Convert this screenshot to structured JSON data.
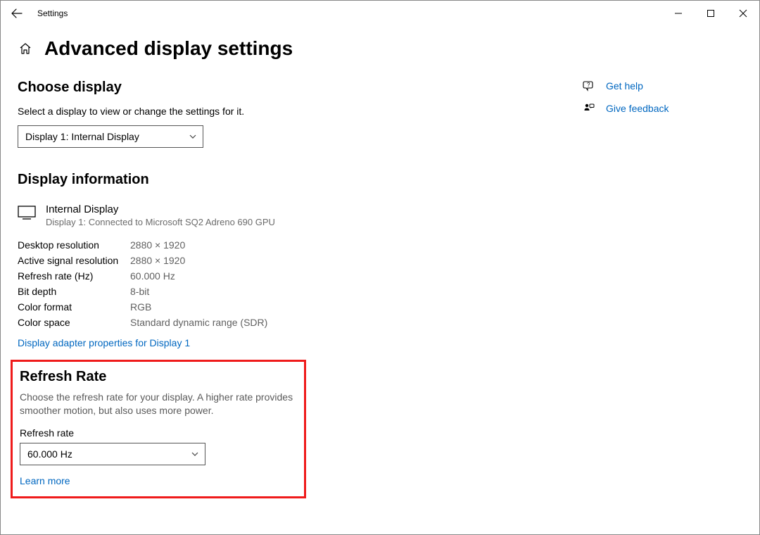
{
  "titlebar": {
    "app_name": "Settings"
  },
  "page": {
    "title": "Advanced display settings"
  },
  "choose_display": {
    "heading": "Choose display",
    "hint": "Select a display to view or change the settings for it.",
    "selected": "Display 1: Internal Display"
  },
  "display_info": {
    "heading": "Display information",
    "name": "Internal Display",
    "subtitle": "Display 1: Connected to Microsoft SQ2 Adreno 690 GPU",
    "rows": [
      {
        "label": "Desktop resolution",
        "value": "2880 × 1920"
      },
      {
        "label": "Active signal resolution",
        "value": "2880 × 1920"
      },
      {
        "label": "Refresh rate (Hz)",
        "value": "60.000 Hz"
      },
      {
        "label": "Bit depth",
        "value": "8-bit"
      },
      {
        "label": "Color format",
        "value": "RGB"
      },
      {
        "label": "Color space",
        "value": "Standard dynamic range (SDR)"
      }
    ],
    "adapter_link": "Display adapter properties for Display 1"
  },
  "refresh_rate": {
    "heading": "Refresh Rate",
    "hint": "Choose the refresh rate for your display. A higher rate provides smoother motion, but also uses more power.",
    "field_label": "Refresh rate",
    "selected": "60.000 Hz",
    "learn_more": "Learn more"
  },
  "side": {
    "help": "Get help",
    "feedback": "Give feedback"
  }
}
